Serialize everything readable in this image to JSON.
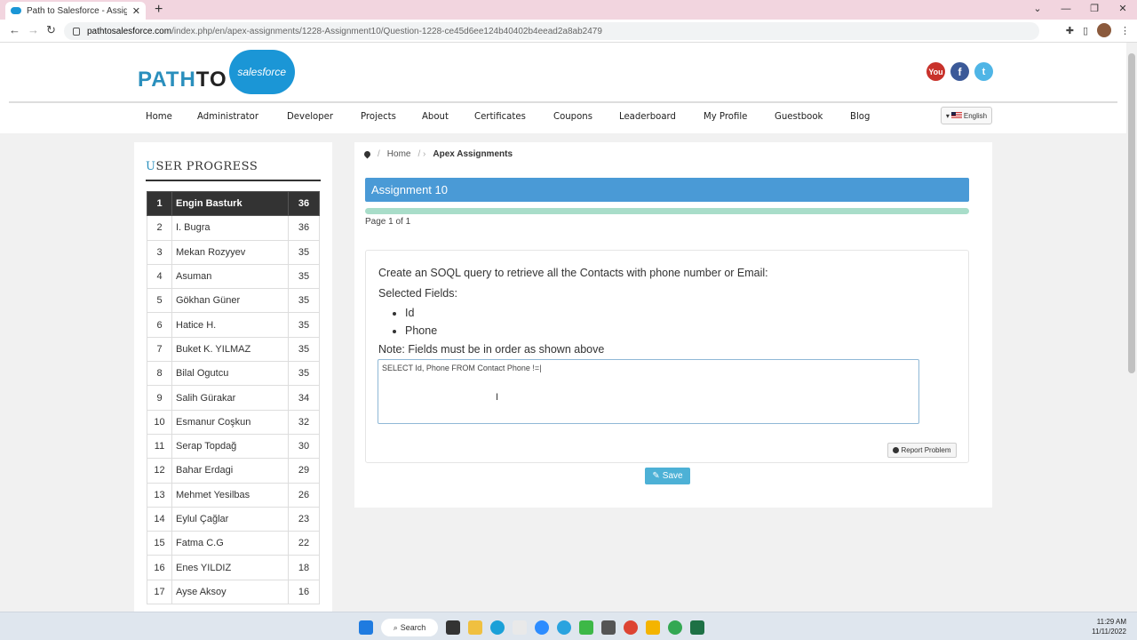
{
  "browser": {
    "tab_title": "Path to Salesforce - Assignments",
    "tab_close": "✕",
    "new_tab": "+",
    "url_domain": "pathtosalesforce.com",
    "url_path": "/index.php/en/apex-assignments/1228-Assignment10/Question-1228-ce45d6ee124b40402b4eead2a8ab2479"
  },
  "site": {
    "logo_left": "PATH",
    "logo_to": "TO",
    "logo_cloud": "salesforce",
    "social": [
      "You",
      "f",
      "t"
    ],
    "nav": [
      "Home",
      "Administrator",
      "Developer",
      "Projects",
      "About",
      "Certificates",
      "Coupons",
      "Leaderboard",
      "My Profile",
      "Guestbook",
      "Blog"
    ],
    "language": "English"
  },
  "sidebar": {
    "title_first": "U",
    "title_rest": "SER PROGRESS",
    "rows": [
      {
        "rank": "1",
        "name": "Engin Basturk",
        "score": "36"
      },
      {
        "rank": "2",
        "name": "I. Bugra",
        "score": "36"
      },
      {
        "rank": "3",
        "name": "Mekan Rozyyev",
        "score": "35"
      },
      {
        "rank": "4",
        "name": "Asuman",
        "score": "35"
      },
      {
        "rank": "5",
        "name": "Gökhan Güner",
        "score": "35"
      },
      {
        "rank": "6",
        "name": "Hatice H.",
        "score": "35"
      },
      {
        "rank": "7",
        "name": "Buket K. YILMAZ",
        "score": "35"
      },
      {
        "rank": "8",
        "name": "Bilal Ogutcu",
        "score": "35"
      },
      {
        "rank": "9",
        "name": "Salih Gürakar",
        "score": "34"
      },
      {
        "rank": "10",
        "name": "Esmanur Coşkun",
        "score": "32"
      },
      {
        "rank": "11",
        "name": "Serap Topdağ",
        "score": "30"
      },
      {
        "rank": "12",
        "name": "Bahar Erdagi",
        "score": "29"
      },
      {
        "rank": "13",
        "name": "Mehmet Yesilbas",
        "score": "26"
      },
      {
        "rank": "14",
        "name": "Eylul Çağlar",
        "score": "23"
      },
      {
        "rank": "15",
        "name": "Fatma C.G",
        "score": "22"
      },
      {
        "rank": "16",
        "name": "Enes YILDIZ",
        "score": "18"
      },
      {
        "rank": "17",
        "name": "Ayse Aksoy",
        "score": "16"
      }
    ]
  },
  "content": {
    "breadcrumb_home": "Home",
    "breadcrumb_current": "Apex Assignments",
    "heading": "Assignment 10",
    "page_info": "Page 1 of 1",
    "question": "Create an SOQL query to retrieve all the Contacts with phone number or Email:",
    "selected_label": "Selected Fields:",
    "fields": [
      "Id",
      "Phone"
    ],
    "note": "Note: Fields must be in order as shown above",
    "answer_value": "SELECT Id, Phone FROM Contact Phone !=",
    "report_label": "Report Problem",
    "save_label": "Save"
  },
  "taskbar": {
    "search_label": "Search",
    "time": "11:29 AM",
    "date": "11/11/2022"
  }
}
